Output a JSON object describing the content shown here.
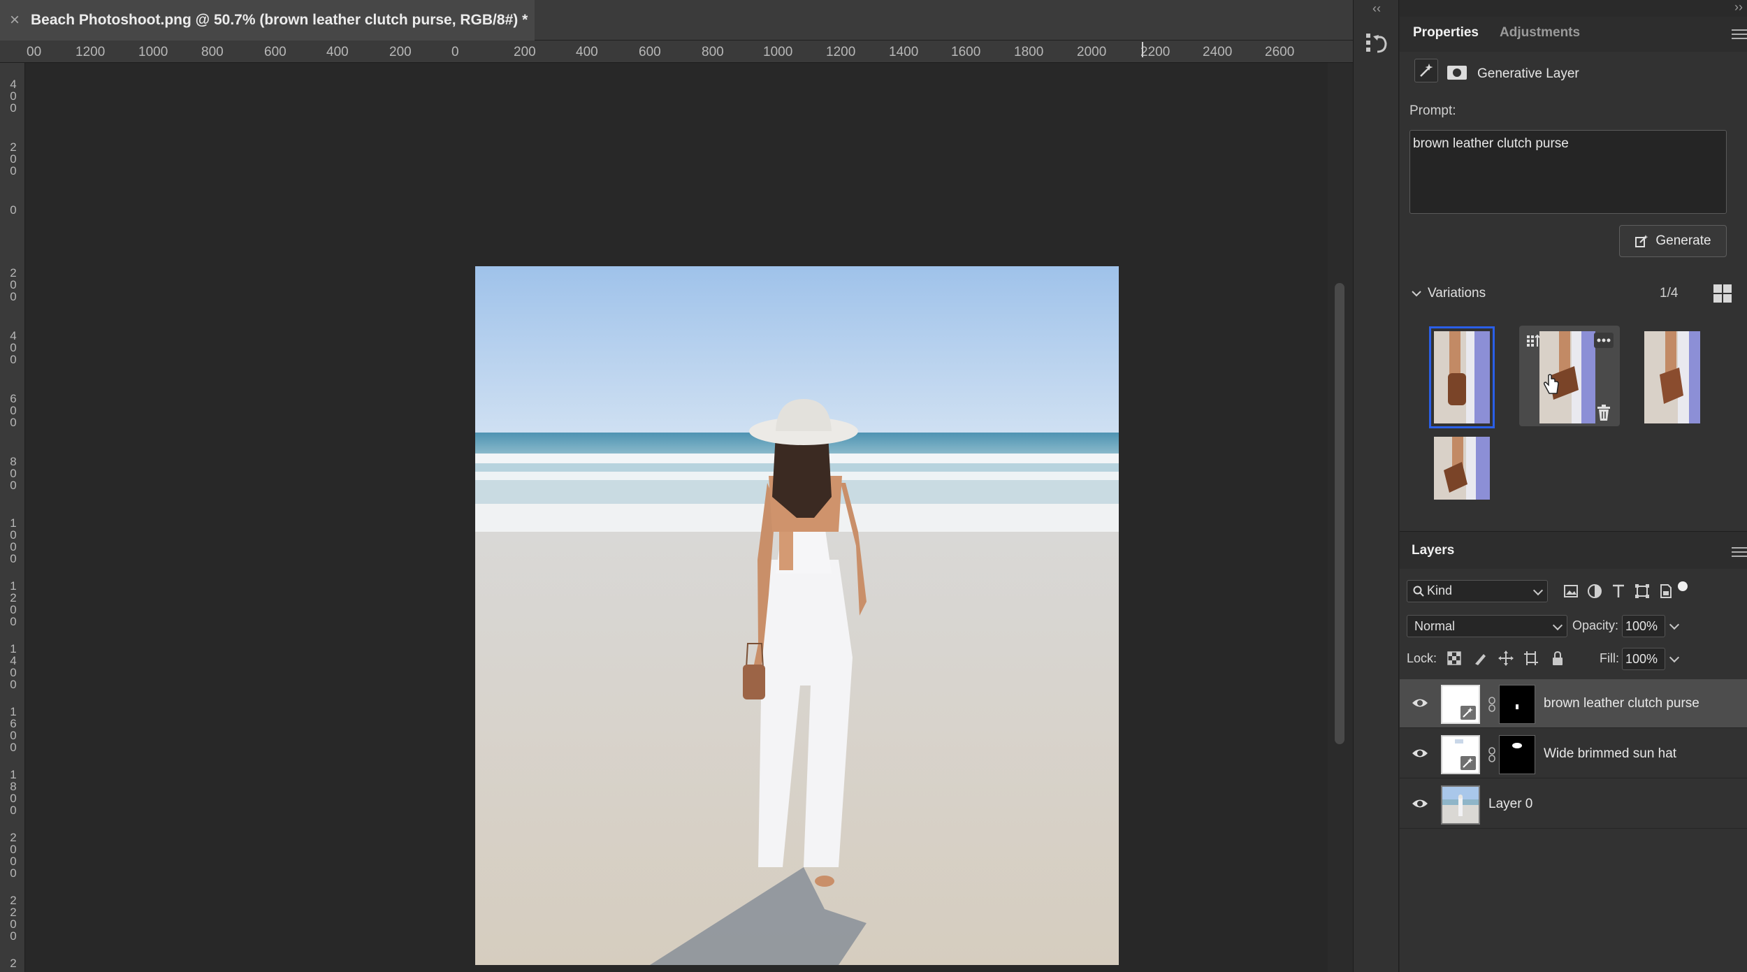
{
  "document_tab": {
    "title": "Beach Photoshoot.png @ 50.7% (brown leather clutch purse, RGB/8#) *",
    "close_glyph": "×"
  },
  "ruler_top": {
    "labels": [
      "00",
      "1200",
      "1000",
      "800",
      "600",
      "400",
      "200",
      "0",
      "200",
      "400",
      "600",
      "800",
      "1000",
      "1200",
      "1400",
      "1600",
      "1800",
      "2000",
      "2200",
      "2400",
      "2600"
    ]
  },
  "ruler_left": {
    "labels": [
      "400",
      "200",
      "0",
      "200",
      "400",
      "600",
      "800",
      "1000",
      "1200",
      "1400",
      "1600",
      "1800",
      "2000",
      "2200",
      "2"
    ]
  },
  "mid_strip": {
    "collapse_glyph": "‹‹",
    "history_icon": "history-icon"
  },
  "panel": {
    "expand_glyph": "››",
    "tabs": [
      {
        "label": "Properties",
        "active": true
      },
      {
        "label": "Adjustments",
        "active": false
      }
    ]
  },
  "properties": {
    "layer_type": "Generative Layer",
    "prompt_label": "Prompt:",
    "prompt_value": "brown leather clutch purse",
    "generate_label": "Generate",
    "variations_label": "Variations",
    "variations_count": "1/4",
    "selected_variation": 1
  },
  "layers": {
    "title": "Layers",
    "kind_label": "Kind",
    "blend_mode": "Normal",
    "opacity_label": "Opacity:",
    "opacity_value": "100%",
    "lock_label": "Lock:",
    "fill_label": "Fill:",
    "fill_value": "100%",
    "items": [
      {
        "name": "brown leather clutch purse",
        "visible": true,
        "selected": true,
        "type": "generative"
      },
      {
        "name": "Wide brimmed sun hat",
        "visible": true,
        "selected": false,
        "type": "generative"
      },
      {
        "name": "Layer 0",
        "visible": true,
        "selected": false,
        "type": "pixel"
      }
    ]
  },
  "colors": {
    "accent": "#2a5fe8",
    "panel_bg": "#323232",
    "canvas_bg": "#282828"
  }
}
